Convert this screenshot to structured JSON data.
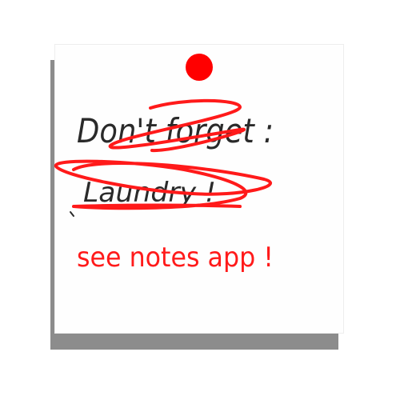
{
  "note": {
    "line1": "Don't forget :",
    "line2": "Laundry !",
    "line3": "see notes app !"
  },
  "colors": {
    "pin": "#ff0000",
    "ink_black": "#2a2a2a",
    "ink_red": "#ff1a1a",
    "shadow": "#8c8c8c",
    "paper": "#fefefe"
  }
}
